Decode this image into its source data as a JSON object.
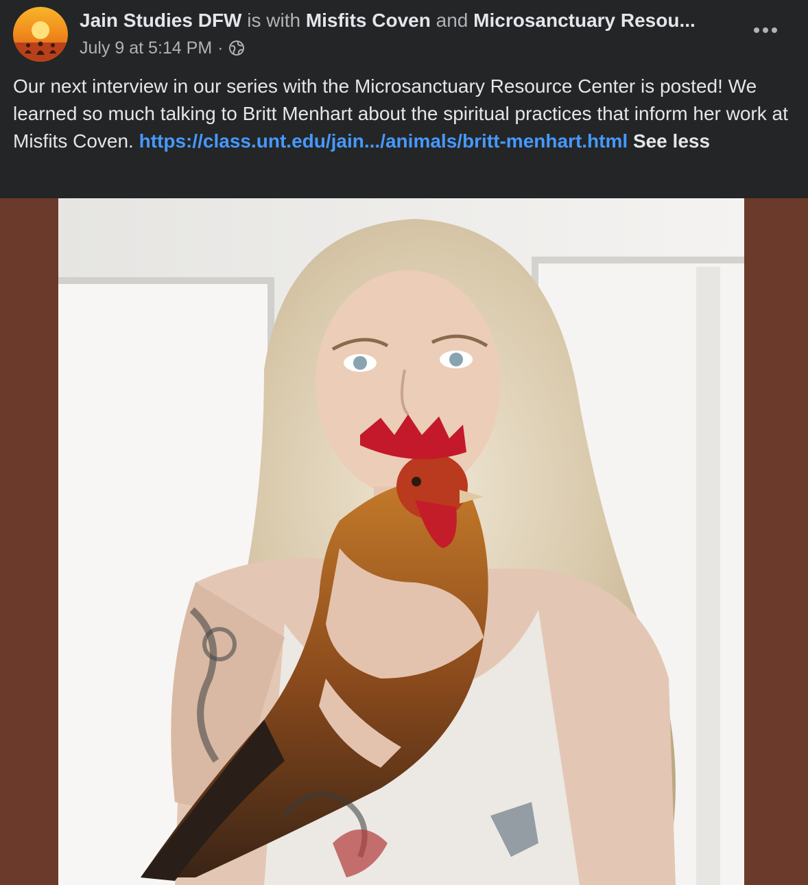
{
  "post": {
    "author": "Jain Studies DFW",
    "with_text": "is with",
    "tagged_1": "Misfits Coven",
    "and_text": "and",
    "tagged_2": "Microsanctuary Resou...",
    "timestamp": "July 9 at 5:14 PM",
    "separator": "·",
    "privacy_icon": "globe-icon",
    "more_icon": "more-options-icon",
    "message_text": "Our next interview in our series with the Microsanctuary Resource Center is posted! We learned so much talking to Britt Menhart about the spiritual practices that inform her work at Misfits Coven.",
    "link_text": "https://class.unt.edu/jain.../animals/britt-menhart.html",
    "see_less": "See less"
  },
  "colors": {
    "background": "#242526",
    "text_primary": "#e4e6eb",
    "text_secondary": "#b0b3b8",
    "link": "#4599ff",
    "media_backdrop": "#6b3a2b"
  }
}
